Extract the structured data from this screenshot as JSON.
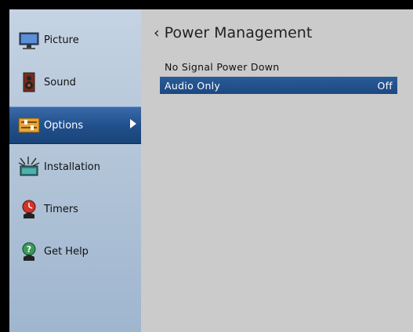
{
  "sidebar": {
    "items": [
      {
        "label": "Picture",
        "icon": "monitor-icon"
      },
      {
        "label": "Sound",
        "icon": "speaker-icon"
      },
      {
        "label": "Options",
        "icon": "options-icon",
        "selected": true
      },
      {
        "label": "Installation",
        "icon": "satellite-antenna-icon"
      },
      {
        "label": "Timers",
        "icon": "timer-icon"
      },
      {
        "label": "Get Help",
        "icon": "help-icon"
      }
    ]
  },
  "main": {
    "back_glyph": "‹",
    "title": "Power Management",
    "rows": [
      {
        "label": "No Signal Power Down",
        "value": ""
      },
      {
        "label": "Audio Only",
        "value": "Off",
        "selected": true
      }
    ]
  },
  "colors": {
    "selection": "#21508d",
    "sidebar": "#b3c5d8",
    "panel": "#cbcbcb"
  }
}
